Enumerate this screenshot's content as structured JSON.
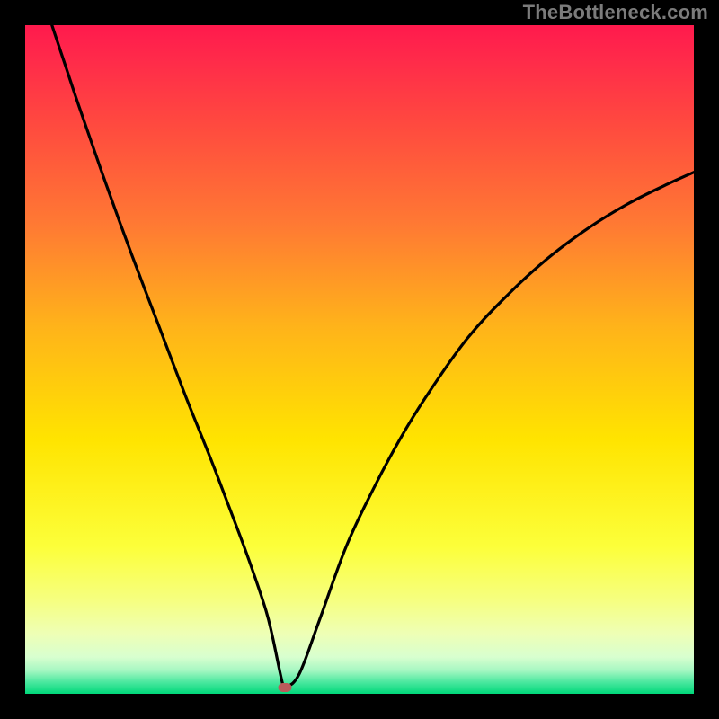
{
  "watermark": "TheBottleneck.com",
  "colors": {
    "background": "#000000",
    "gradient_stops": [
      {
        "offset": 0.0,
        "color": "#ff1a4d"
      },
      {
        "offset": 0.05,
        "color": "#ff2a4a"
      },
      {
        "offset": 0.15,
        "color": "#ff4a3f"
      },
      {
        "offset": 0.3,
        "color": "#ff7a33"
      },
      {
        "offset": 0.45,
        "color": "#ffb31a"
      },
      {
        "offset": 0.62,
        "color": "#ffe400"
      },
      {
        "offset": 0.78,
        "color": "#fcff3a"
      },
      {
        "offset": 0.86,
        "color": "#f6ff80"
      },
      {
        "offset": 0.91,
        "color": "#eeffb5"
      },
      {
        "offset": 0.945,
        "color": "#d8ffcf"
      },
      {
        "offset": 0.965,
        "color": "#a6f7c2"
      },
      {
        "offset": 0.982,
        "color": "#4de8a0"
      },
      {
        "offset": 1.0,
        "color": "#00d87a"
      }
    ],
    "curve": "#000000",
    "marker": "#bb5b5b"
  },
  "chart_data": {
    "type": "line",
    "title": "",
    "xlabel": "",
    "ylabel": "",
    "x_range": [
      0,
      100
    ],
    "y_range": [
      0,
      100
    ],
    "grid": false,
    "legend": null,
    "series": [
      {
        "name": "curve",
        "x": [
          4.0,
          6.0,
          8.0,
          12.0,
          16.0,
          20.0,
          24.0,
          28.0,
          32.0,
          34.0,
          36.0,
          37.0,
          38.5,
          39.0,
          41.0,
          44.0,
          48.0,
          52.0,
          56.0,
          60.0,
          66.0,
          72.0,
          78.0,
          84.0,
          90.0,
          96.0,
          100.0
        ],
        "y": [
          100.0,
          94.0,
          88.0,
          76.5,
          65.5,
          55.0,
          44.5,
          34.5,
          24.0,
          18.5,
          12.5,
          8.5,
          1.5,
          1.0,
          3.0,
          11.0,
          22.0,
          30.5,
          38.0,
          44.5,
          53.0,
          59.5,
          65.0,
          69.5,
          73.2,
          76.2,
          78.0
        ]
      }
    ],
    "marker": {
      "x": 38.8,
      "y": 0.9
    },
    "notes": "V-shaped bottleneck curve over a vertical heat gradient; y≈0 is optimal (green), high y is severe (red)."
  }
}
